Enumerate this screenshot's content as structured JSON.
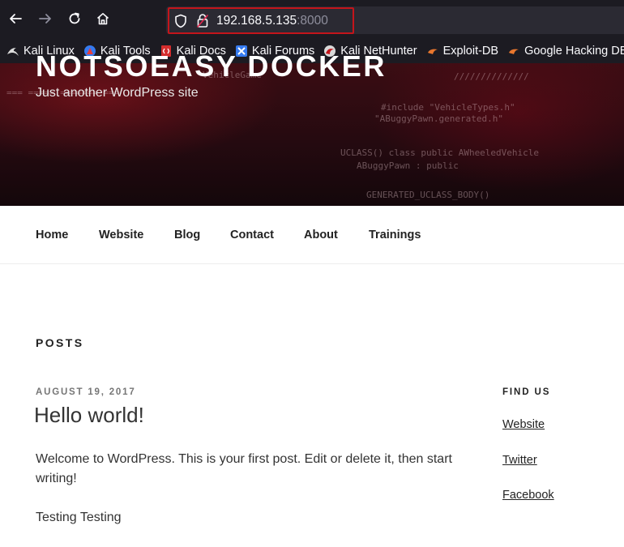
{
  "browser": {
    "url_host": "192.168.5.135",
    "url_port": ":8000",
    "bookmarks": [
      {
        "label": "Kali Linux",
        "icon": "kali-dragon-icon"
      },
      {
        "label": "Kali Tools",
        "icon": "kali-tools-icon"
      },
      {
        "label": "Kali Docs",
        "icon": "kali-docs-icon"
      },
      {
        "label": "Kali Forums",
        "icon": "kali-forums-icon"
      },
      {
        "label": "Kali NetHunter",
        "icon": "kali-nethunter-icon"
      },
      {
        "label": "Exploit-DB",
        "icon": "exploit-db-icon"
      },
      {
        "label": "Google Hacking DB",
        "icon": "ghdb-icon"
      }
    ]
  },
  "site": {
    "title": "NOTSOEASY DOCKER",
    "description": "Just another WordPress site"
  },
  "nav": {
    "items": [
      "Home",
      "Website",
      "Blog",
      "Contact",
      "About",
      "Trainings"
    ]
  },
  "main": {
    "heading": "POSTS",
    "post": {
      "date": "AUGUST 19, 2017",
      "title": "Hello world!",
      "paragraphs": [
        "Welcome to WordPress. This is your first post. Edit or delete it, then start writing!",
        "Testing Testing"
      ]
    }
  },
  "sidebar": {
    "title": "FIND US",
    "links": [
      "Website",
      "Twitter",
      "Facebook"
    ]
  },
  "colors": {
    "chrome_bg": "#1c1b22",
    "urlbar_bg": "#2b2a33",
    "highlight": "#c4151b",
    "text": "#333333"
  }
}
